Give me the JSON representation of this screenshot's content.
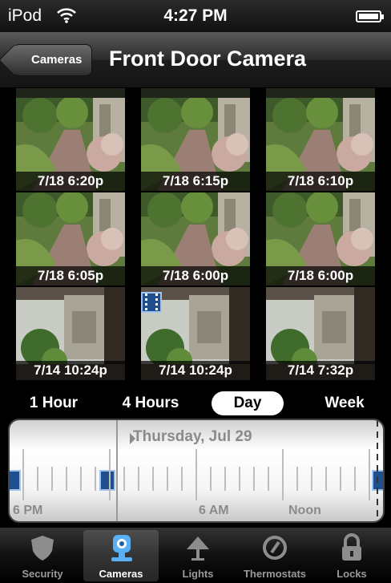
{
  "status_bar": {
    "carrier": "iPod",
    "time": "4:27 PM"
  },
  "nav": {
    "back_label": "Cameras",
    "title": "Front Door Camera"
  },
  "thumbnails": [
    {
      "time": "7/18 6:20p",
      "scene": "garden"
    },
    {
      "time": "7/18 6:15p",
      "scene": "garden"
    },
    {
      "time": "7/18 6:10p",
      "scene": "garden"
    },
    {
      "time": "7/18 6:05p",
      "scene": "garden"
    },
    {
      "time": "7/18 6:00p",
      "scene": "garden"
    },
    {
      "time": "7/18 6:00p",
      "scene": "garden"
    },
    {
      "time": "7/14 10:24p",
      "scene": "porch"
    },
    {
      "time": "7/14 10:24p",
      "scene": "porch",
      "video": true
    },
    {
      "time": "7/14 7:32p",
      "scene": "porch"
    }
  ],
  "ranges": [
    "1 Hour",
    "4 Hours",
    "Day",
    "Week"
  ],
  "selected_range": "Day",
  "timeline": {
    "date": "Thursday, Jul 29",
    "labels": [
      "6 PM",
      "6 AM",
      "Noon"
    ]
  },
  "tabs": [
    {
      "label": "Security",
      "icon": "shield-icon"
    },
    {
      "label": "Cameras",
      "icon": "camera-icon",
      "active": true
    },
    {
      "label": "Lights",
      "icon": "lamp-icon"
    },
    {
      "label": "Thermostats",
      "icon": "thermostat-icon"
    },
    {
      "label": "Locks",
      "icon": "lock-icon"
    }
  ],
  "colors": {
    "accent": "#1f4f8c",
    "selected_range_bg": "#ffffff"
  }
}
